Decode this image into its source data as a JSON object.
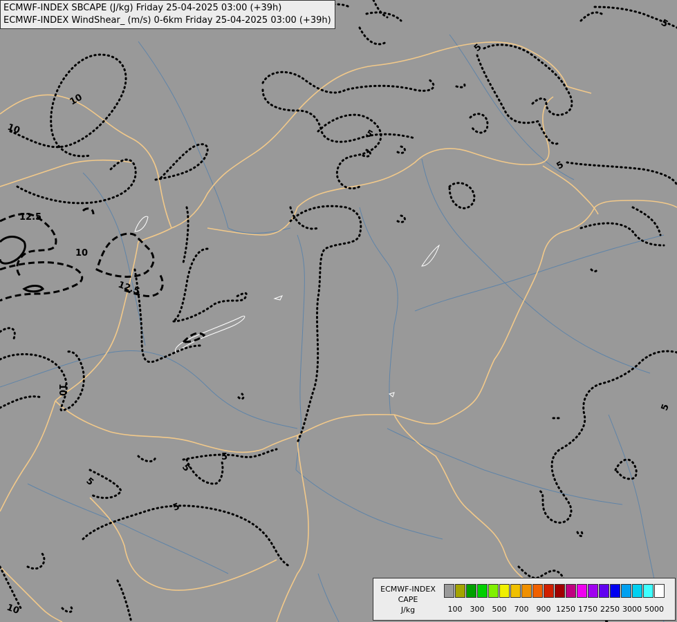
{
  "header": {
    "line1": "ECMWF-INDEX SBCAPE (J/kg) Friday 25-04-2025 03:00 (+39h)",
    "line2": "ECMWF-INDEX WindShear_ (m/s) 0-6km Friday 25-04-2025 03:00 (+39h)"
  },
  "contour_labels": {
    "l10a": "10",
    "l10b": "10",
    "l125a": "12.5",
    "l10c": "10",
    "l125b": "12.5",
    "l5a": "5",
    "l5b": "5",
    "l5c": "5",
    "l5d": "5",
    "l10d": "10",
    "l5e": "5",
    "l5f": "5",
    "l5g": "5",
    "l5h": "5",
    "l10e": "10",
    "l5i": "5"
  },
  "legend": {
    "title_line1": "ECMWF-INDEX",
    "title_line2": "CAPE",
    "title_line3": "J/kg",
    "colors": [
      "#999999",
      "#a4a400",
      "#00a000",
      "#00d000",
      "#80f000",
      "#f0f000",
      "#f0c000",
      "#f09000",
      "#f06000",
      "#d02000",
      "#a00000",
      "#c00080",
      "#f000f0",
      "#a000f0",
      "#6000f0",
      "#0000f0",
      "#00a0f0",
      "#00d0f0",
      "#40ffff",
      "#ffffff"
    ],
    "ticks": [
      "100",
      "300",
      "500",
      "700",
      "900",
      "1250",
      "1750",
      "2250",
      "3000",
      "5000"
    ]
  }
}
